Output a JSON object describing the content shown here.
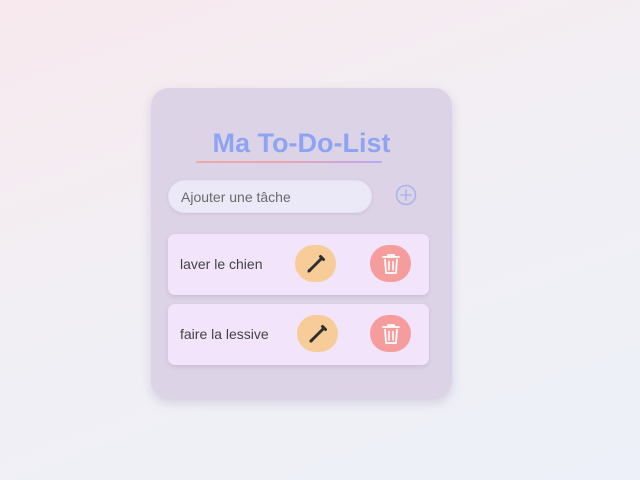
{
  "app": {
    "title": "Ma To-Do-List"
  },
  "input": {
    "placeholder": "Ajouter une tâche",
    "value": ""
  },
  "icons": {
    "add": "plus-circle-icon",
    "edit": "pencil-icon",
    "delete": "trash-icon"
  },
  "tasks": [
    {
      "text": "laver le chien"
    },
    {
      "text": "faire la lessive"
    }
  ],
  "colors": {
    "title": "#8ea4f2",
    "card_background": "#ddd3e6",
    "task_background": "#f1e4fb",
    "edit_button": "#f7cc98",
    "delete_button": "#f59d9d",
    "add_icon": "#a8b4ee"
  }
}
